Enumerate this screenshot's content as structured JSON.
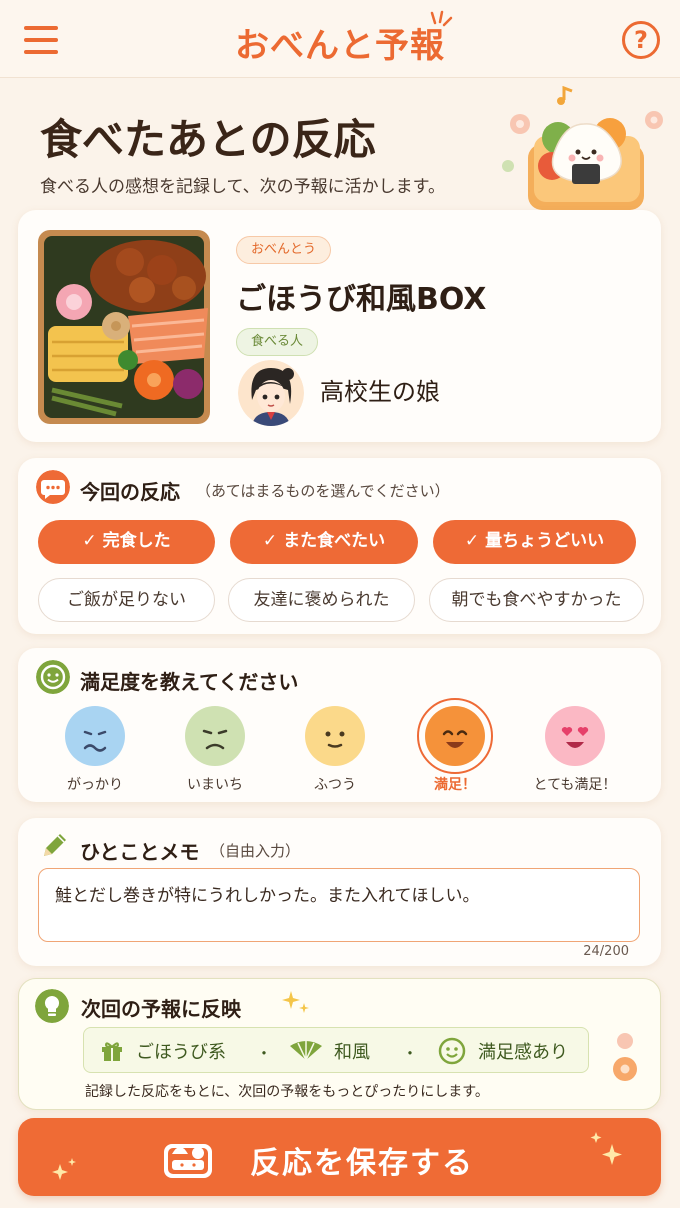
{
  "app": {
    "title": "おべんと予報"
  },
  "header": {
    "title": "食べたあとの反応",
    "subtitle": "食べる人の感想を記録して、次の予報に活かします。"
  },
  "bento": {
    "tag": "おべんとう",
    "name": "ごほうび和風BOX",
    "eater_tag": "食べる人",
    "eater": "高校生の娘"
  },
  "reaction": {
    "title": "今回の反応",
    "note": "（あてはまるものを選んでください）",
    "chips": [
      {
        "label": "完食した",
        "selected": true
      },
      {
        "label": "また食べたい",
        "selected": true
      },
      {
        "label": "量ちょうどいい",
        "selected": true
      },
      {
        "label": "ご飯が足りない",
        "selected": false
      },
      {
        "label": "友達に褒められた",
        "selected": false
      },
      {
        "label": "朝でも食べやすかった",
        "selected": false
      }
    ]
  },
  "satisfaction": {
    "title": "満足度を教えてください",
    "options": [
      {
        "label": "がっかり",
        "icon": "disappointed-face-icon",
        "color": "#a9d4f2"
      },
      {
        "label": "いまいち",
        "icon": "meh-face-icon",
        "color": "#cfe1b2"
      },
      {
        "label": "ふつう",
        "icon": "neutral-face-icon",
        "color": "#fbd98a"
      },
      {
        "label": "満足！",
        "icon": "happy-face-icon",
        "color": "#f5923a"
      },
      {
        "label": "とても満足！",
        "icon": "heart-eyes-face-icon",
        "color": "#fbb8c4"
      }
    ],
    "selected": "満足！"
  },
  "memo": {
    "title": "ひとことメモ",
    "note": "（自由入力）",
    "value": "鮭とだし巻きが特にうれしかった。また入れてほしい。",
    "count": "24/200"
  },
  "next": {
    "title": "次回の予報に反映",
    "tags": [
      "ごほうび系",
      "和風",
      "満足感あり"
    ],
    "separator": "・",
    "note": "記録した反応をもとに、次回の予報をもっとぴったりにします。"
  },
  "save": {
    "label": "反応を保存する"
  },
  "colors": {
    "accent": "#ec6a32",
    "green": "#7fa53c",
    "background": "#fbf3ea"
  }
}
